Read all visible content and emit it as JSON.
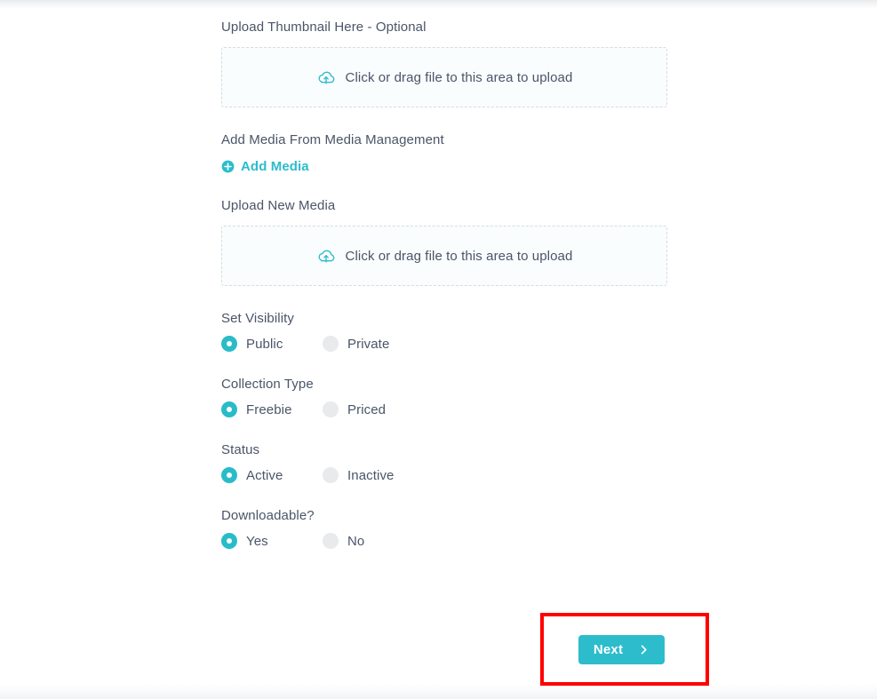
{
  "form": {
    "thumbnail": {
      "label": "Upload Thumbnail Here - Optional",
      "dropzone_text": "Click or drag file to this area to upload",
      "icon": "cloud-upload-icon"
    },
    "media_management": {
      "label": "Add Media From Media Management",
      "add_media_label": "Add Media",
      "add_media_icon": "plus-circle-icon"
    },
    "new_media": {
      "label": "Upload New Media",
      "dropzone_text": "Click or drag file to this area to upload",
      "icon": "cloud-upload-icon"
    },
    "radio_groups": [
      {
        "name": "set-visibility",
        "label": "Set Visibility",
        "options": [
          {
            "label": "Public",
            "selected": true
          },
          {
            "label": "Private",
            "selected": false
          }
        ]
      },
      {
        "name": "collection-type",
        "label": "Collection Type",
        "options": [
          {
            "label": "Freebie",
            "selected": true
          },
          {
            "label": "Priced",
            "selected": false
          }
        ]
      },
      {
        "name": "status",
        "label": "Status",
        "options": [
          {
            "label": "Active",
            "selected": true
          },
          {
            "label": "Inactive",
            "selected": false
          }
        ]
      },
      {
        "name": "downloadable",
        "label": "Downloadable?",
        "options": [
          {
            "label": "Yes",
            "selected": true
          },
          {
            "label": "No",
            "selected": false
          }
        ]
      }
    ]
  },
  "footer": {
    "next_label": "Next",
    "next_icon": "chevron-right-icon",
    "highlight_color": "#ff0000"
  },
  "colors": {
    "accent": "#2cbccc",
    "radio_on": "#29bcc8",
    "radio_off": "#e9eaeb",
    "text": "#4a5568",
    "dropzone_bg": "#fafdfe",
    "dropzone_border": "#d6dce2"
  }
}
